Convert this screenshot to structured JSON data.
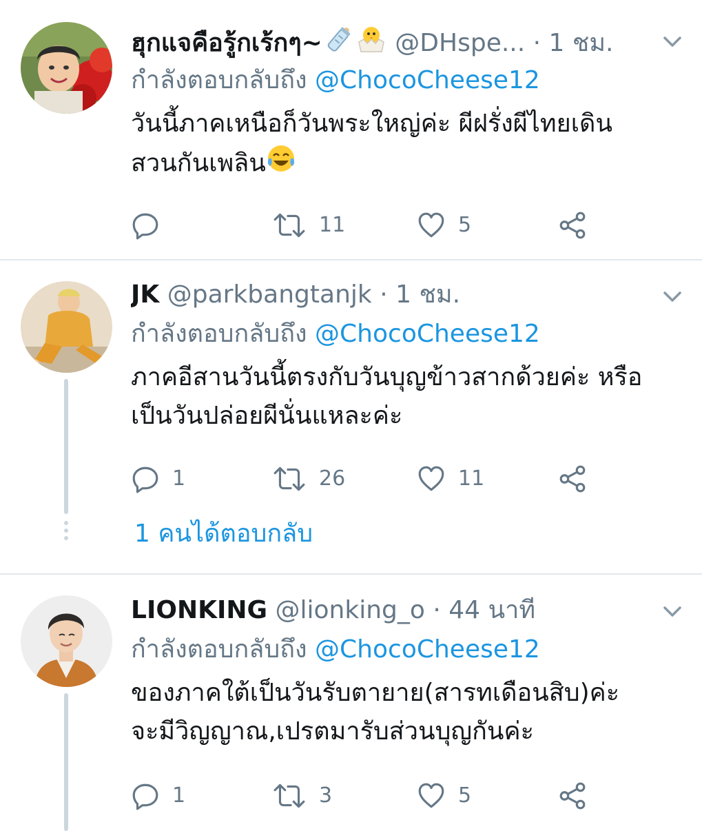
{
  "tweets": [
    {
      "display_name": "ฮุกแจคือรู้กเร้กๆ~",
      "handle": "@DHspe...",
      "separator": "·",
      "time": "1 ชม.",
      "replying_label": "กำลังตอบกลับถึง",
      "replying_to": "@ChocoCheese12",
      "text_line1": "วันนี้ภาคเหนือก็วันพระใหญ่ค่ะ ผีฝรั่งผีไทยเดิน",
      "text_line2": "สวนกันเพลิน",
      "reply_count": "",
      "retweet_count": "11",
      "like_count": "5",
      "name_emojis": [
        "baby-bottle-icon",
        "hatching-chick-icon"
      ],
      "text_emoji": "tears-of-joy-icon"
    },
    {
      "display_name": "JK",
      "handle": "@parkbangtanjk",
      "separator": "·",
      "time": "1 ชม.",
      "replying_label": "กำลังตอบกลับถึง",
      "replying_to": "@ChocoCheese12",
      "text_line1": "ภาคอีสานวันนี้ตรงกับวันบุญข้าวสากด้วยค่ะ หรือ",
      "text_line2": "เป็นวันปล่อยผีนั่นแหละค่ะ",
      "reply_count": "1",
      "retweet_count": "26",
      "like_count": "11",
      "more_replies": "1 คนได้ตอบกลับ"
    },
    {
      "display_name": "LIONKING",
      "handle": "@lionking_o",
      "separator": "·",
      "time": "44 นาที",
      "replying_label": "กำลังตอบกลับถึง",
      "replying_to": "@ChocoCheese12",
      "text_line1": "ของภาคใต้เป็นวันรับตายาย(สารทเดือนสิบ)ค่ะ",
      "text_line2": "จะมีวิญญาณ,เปรตมารับส่วนบุญกันค่ะ",
      "reply_count": "1",
      "retweet_count": "3",
      "like_count": "5"
    }
  ],
  "colors": {
    "link": "#1b95e0",
    "secondary": "#657786",
    "divider": "#e1e8ed",
    "thread": "#ccd6dd"
  }
}
